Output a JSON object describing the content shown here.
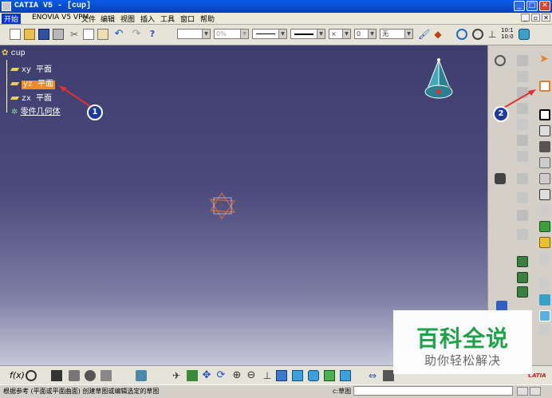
{
  "window": {
    "title": "CATIA V5 - [cup]"
  },
  "menu": {
    "items": [
      "开始",
      "ENOVIA V5 VPM",
      "文件",
      "编辑",
      "视图",
      "插入",
      "工具",
      "窗口",
      "帮助"
    ]
  },
  "toolbar": {
    "line_color": "",
    "line_thickness": "0%",
    "line_type": "",
    "line_weight": "",
    "point_type": "×",
    "layer": "0",
    "layer_filter": "无",
    "zoom_ratio_top": "10:1",
    "zoom_ratio_bottom": "10:0"
  },
  "tree": {
    "root": "cup",
    "items": [
      {
        "label": "xy 平面",
        "selected": false
      },
      {
        "label": "yz 平面",
        "selected": true
      },
      {
        "label": "zx 平面",
        "selected": false
      },
      {
        "label": "零件几何体",
        "selected": false
      }
    ]
  },
  "annotations": {
    "badge1": "1",
    "badge2": "2"
  },
  "formula_label": "f(x)",
  "status": {
    "message": "根据参考 (平面或平面曲面) 创建草图或编辑选定的草图",
    "command_label": "c:草图"
  },
  "branding": {
    "catia": "CATIA"
  },
  "watermark": {
    "line1": "百科全说",
    "line2": "助你轻松解决"
  },
  "icons": [
    "app-icon",
    "new-icon",
    "open-icon",
    "save-icon",
    "print-icon",
    "cut-icon",
    "copy-icon",
    "paste-icon",
    "undo-icon",
    "redo-icon",
    "help-icon",
    "brush-icon",
    "sketch-icon",
    "compass-icon",
    "axis-icon",
    "select-arrow-icon",
    "sketcher-icon",
    "pad-icon",
    "formula-icon",
    "ruler-icon"
  ],
  "colors": {
    "selection": "#f08a24",
    "titlebar": "#0a5be6",
    "annotation_arrow": "#e03030",
    "badge": "#1f3a9e",
    "watermark_green": "#1fa14a"
  }
}
